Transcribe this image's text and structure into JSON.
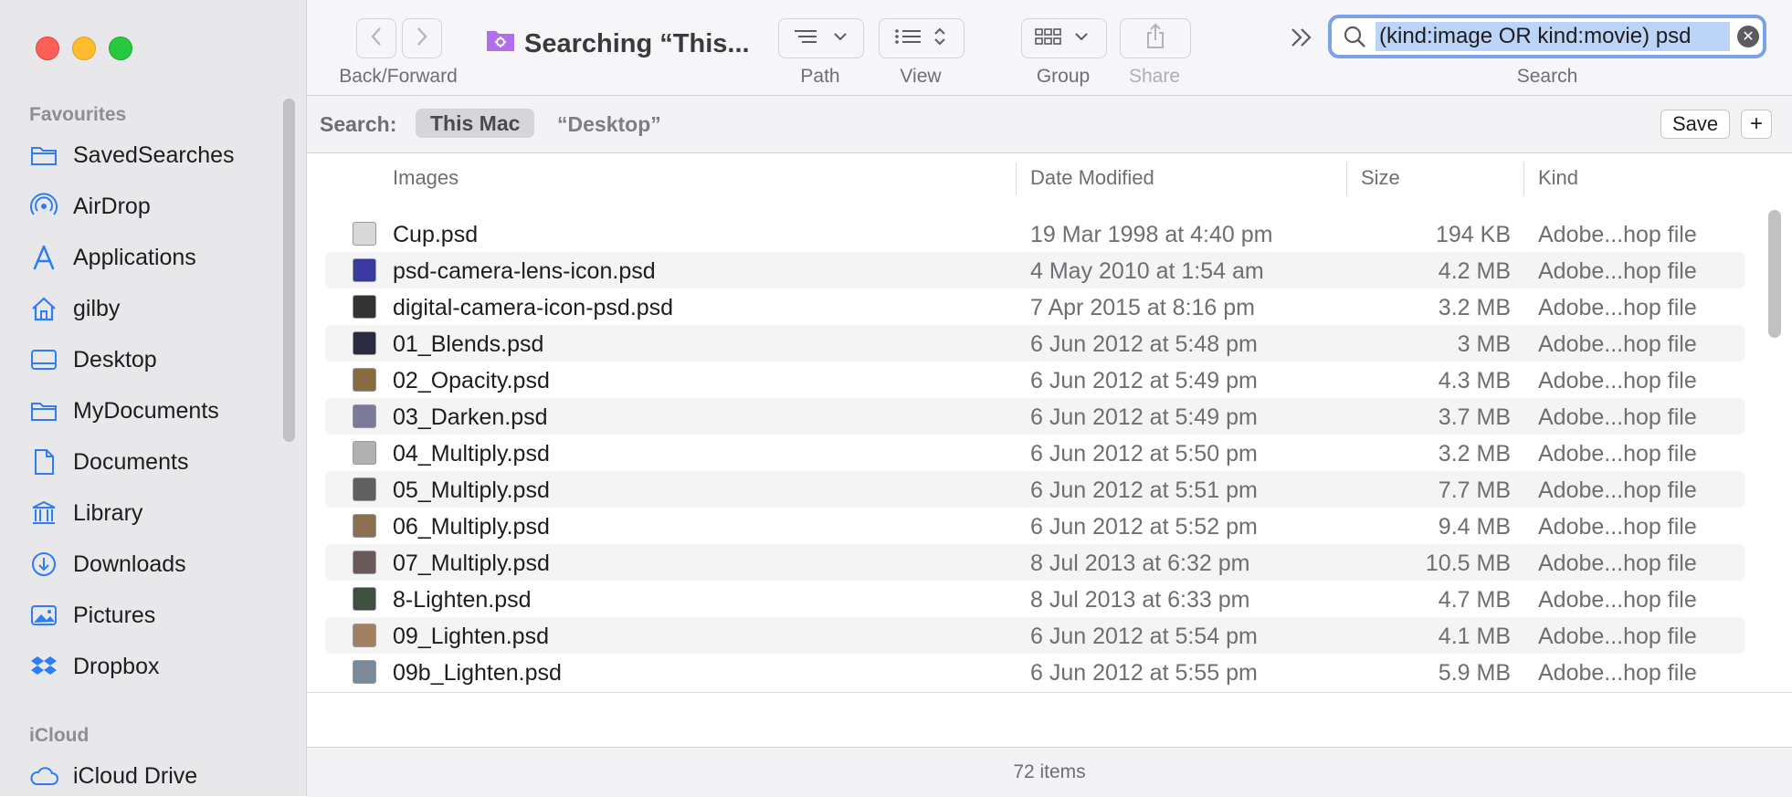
{
  "sidebar": {
    "favourites_heading": "Favourites",
    "items": [
      {
        "label": "SavedSearches",
        "icon": "folder-icon"
      },
      {
        "label": "AirDrop",
        "icon": "airdrop-icon"
      },
      {
        "label": "Applications",
        "icon": "applications-icon"
      },
      {
        "label": "gilby",
        "icon": "home-icon"
      },
      {
        "label": "Desktop",
        "icon": "desktop-icon"
      },
      {
        "label": "MyDocuments",
        "icon": "folder-icon"
      },
      {
        "label": "Documents",
        "icon": "document-icon"
      },
      {
        "label": "Library",
        "icon": "library-icon"
      },
      {
        "label": "Downloads",
        "icon": "downloads-icon"
      },
      {
        "label": "Pictures",
        "icon": "pictures-icon"
      },
      {
        "label": "Dropbox",
        "icon": "dropbox-icon"
      }
    ],
    "icloud_heading": "iCloud",
    "icloud_items": [
      {
        "label": "iCloud Drive",
        "icon": "cloud-icon"
      }
    ]
  },
  "toolbar": {
    "back_forward_label": "Back/Forward",
    "title": "Searching “This...",
    "path_label": "Path",
    "view_label": "View",
    "group_label": "Group",
    "share_label": "Share",
    "search_label": "Search",
    "search_value": "(kind:image OR kind:movie) psd"
  },
  "scope": {
    "label": "Search:",
    "this_mac": "This Mac",
    "desktop": "“Desktop”",
    "save": "Save",
    "plus": "+"
  },
  "columns": {
    "name": "Images",
    "date": "Date Modified",
    "size": "Size",
    "kind": "Kind"
  },
  "rows": [
    {
      "name": "Cup.psd",
      "date": "19 Mar 1998 at 4:40 pm",
      "size": "194 KB",
      "kind": "Adobe...hop file"
    },
    {
      "name": "psd-camera-lens-icon.psd",
      "date": "4 May 2010 at 1:54 am",
      "size": "4.2 MB",
      "kind": "Adobe...hop file"
    },
    {
      "name": "digital-camera-icon-psd.psd",
      "date": "7 Apr 2015 at 8:16 pm",
      "size": "3.2 MB",
      "kind": "Adobe...hop file"
    },
    {
      "name": "01_Blends.psd",
      "date": "6 Jun 2012 at 5:48 pm",
      "size": "3 MB",
      "kind": "Adobe...hop file"
    },
    {
      "name": "02_Opacity.psd",
      "date": "6 Jun 2012 at 5:49 pm",
      "size": "4.3 MB",
      "kind": "Adobe...hop file"
    },
    {
      "name": "03_Darken.psd",
      "date": "6 Jun 2012 at 5:49 pm",
      "size": "3.7 MB",
      "kind": "Adobe...hop file"
    },
    {
      "name": "04_Multiply.psd",
      "date": "6 Jun 2012 at 5:50 pm",
      "size": "3.2 MB",
      "kind": "Adobe...hop file"
    },
    {
      "name": "05_Multiply.psd",
      "date": "6 Jun 2012 at 5:51 pm",
      "size": "7.7 MB",
      "kind": "Adobe...hop file"
    },
    {
      "name": "06_Multiply.psd",
      "date": "6 Jun 2012 at 5:52 pm",
      "size": "9.4 MB",
      "kind": "Adobe...hop file"
    },
    {
      "name": "07_Multiply.psd",
      "date": "8 Jul 2013 at 6:32 pm",
      "size": "10.5 MB",
      "kind": "Adobe...hop file"
    },
    {
      "name": "8-Lighten.psd",
      "date": "8 Jul 2013 at 6:33 pm",
      "size": "4.7 MB",
      "kind": "Adobe...hop file"
    },
    {
      "name": "09_Lighten.psd",
      "date": "6 Jun 2012 at 5:54 pm",
      "size": "4.1 MB",
      "kind": "Adobe...hop file"
    },
    {
      "name": "09b_Lighten.psd",
      "date": "6 Jun 2012 at 5:55 pm",
      "size": "5.9 MB",
      "kind": "Adobe...hop file"
    }
  ],
  "status": {
    "item_count": "72 items"
  },
  "colors": {
    "accent": "#2e7cf6",
    "sidebar_bg": "#e8e8ea",
    "search_focus": "#7aa2ea"
  }
}
